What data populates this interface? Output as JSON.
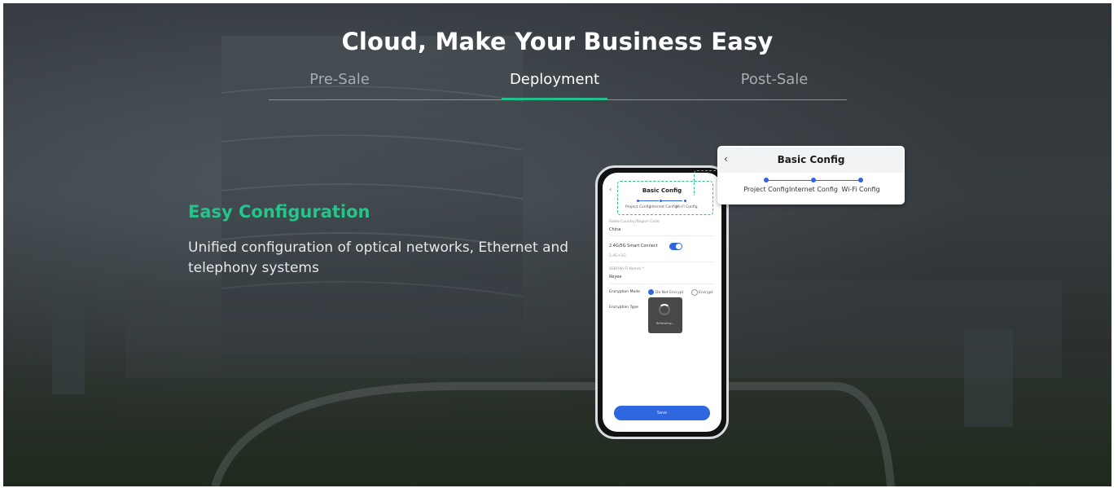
{
  "hero": {
    "title": "Cloud, Make Your Business Easy"
  },
  "tabs": [
    {
      "label": "Pre-Sale",
      "active": false
    },
    {
      "label": "Deployment",
      "active": true
    },
    {
      "label": "Post-Sale",
      "active": false
    }
  ],
  "feature": {
    "title": "Easy Configuration",
    "description": "Unified configuration of optical networks, Ethernet and telephony systems"
  },
  "popup": {
    "title": "Basic Config",
    "steps": [
      "Project Config",
      "Internet Config",
      "Wi-Fi Config"
    ]
  },
  "phone": {
    "header": "Basic Config",
    "steps": [
      "Project Config",
      "Internet Config",
      "Wi-Fi Config"
    ],
    "country_label": "Radio Country/Region Code",
    "country_value": "China",
    "smart_connect_label": "2.4G/5G Smart Connect",
    "band_value": "2.4G+5G",
    "ssid_label": "SSID(Wi-Fi Name) *",
    "ssid_value": "Reyee",
    "encryption_mode_label": "Encryption Mode",
    "no_encrypt_label": "Do Not Encrypt",
    "encrypt_label": "Encrypt",
    "encryption_type_label": "Encryption Type",
    "toast_text": "Refreshing...",
    "save_label": "Save"
  },
  "colors": {
    "accent_green": "#1fc28a",
    "primary_blue": "#2f67e0",
    "background_dark": "#30353a"
  }
}
